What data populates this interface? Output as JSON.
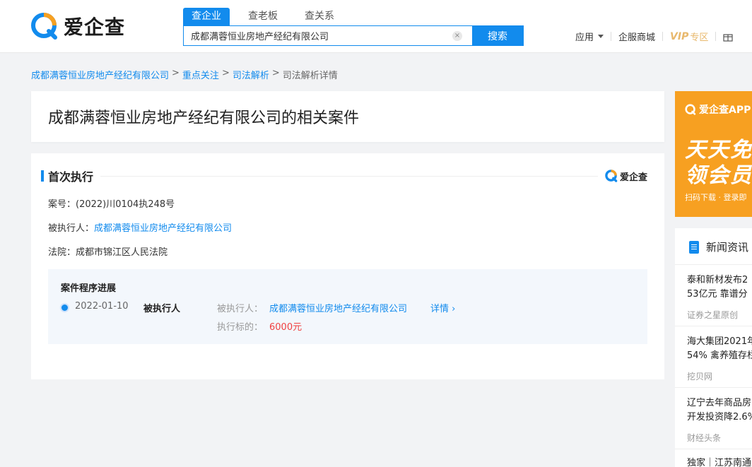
{
  "header": {
    "logo_text": "爱企查",
    "tabs": [
      {
        "label": "查企业",
        "active": true
      },
      {
        "label": "查老板",
        "active": false
      },
      {
        "label": "查关系",
        "active": false
      }
    ],
    "search_value": "成都满蓉恒业房地产经纪有限公司",
    "search_button": "搜索",
    "clear_icon": "×",
    "nav": {
      "app": "应用",
      "mall": "企服商城",
      "vip": "VIP",
      "vip_sub": "专区"
    }
  },
  "breadcrumb": [
    {
      "label": "成都满蓉恒业房地产经纪有限公司",
      "link": true
    },
    {
      "label": "重点关注",
      "link": true
    },
    {
      "label": "司法解析",
      "link": true
    },
    {
      "label": "司法解析详情",
      "link": false
    }
  ],
  "breadcrumb_sep": ">",
  "page_title": "成都满蓉恒业房地产经纪有限公司的相关案件",
  "section": {
    "title": "首次执行",
    "logo_text": "爱企查",
    "case_no_label": "案号：",
    "case_no": "(2022)川0104执248号",
    "executed_label": "被执行人：",
    "executed_name": "成都满蓉恒业房地产经纪有限公司",
    "court_label": "法院：",
    "court": "成都市锦江区人民法院",
    "progress": {
      "title": "案件程序进展",
      "date": "2022-01-10",
      "role": "被执行人",
      "executed_label": "被执行人：",
      "executed_name": "成都满蓉恒业房地产经纪有限公司",
      "detail_link": "详情 ›",
      "target_label": "执行标的：",
      "target_amount": "6000元"
    }
  },
  "ad": {
    "top": "爱企查APP",
    "line1": "天天免",
    "line2": "领会员",
    "small": "扫码下载 · 登录即"
  },
  "news": {
    "header": "新闻资讯",
    "items": [
      {
        "title_line1": "泰和新材发布2",
        "title_line2": "53亿元 靠谱分",
        "source": "证券之星原创"
      },
      {
        "title_line1": "海大集团2021年",
        "title_line2": "54% 禽养殖存栏",
        "source": "挖贝网"
      },
      {
        "title_line1": "辽宁去年商品房",
        "title_line2": "开发投资降2.6%",
        "source": "财经头条"
      },
      {
        "title_line1": "独家｜江苏南通",
        "title_line2": "",
        "source": ""
      }
    ]
  },
  "colors": {
    "brand_blue": "#128bed",
    "amount_red": "#f04040",
    "vip_gold": "#e8b86c",
    "ad_orange": "#f7a021"
  }
}
